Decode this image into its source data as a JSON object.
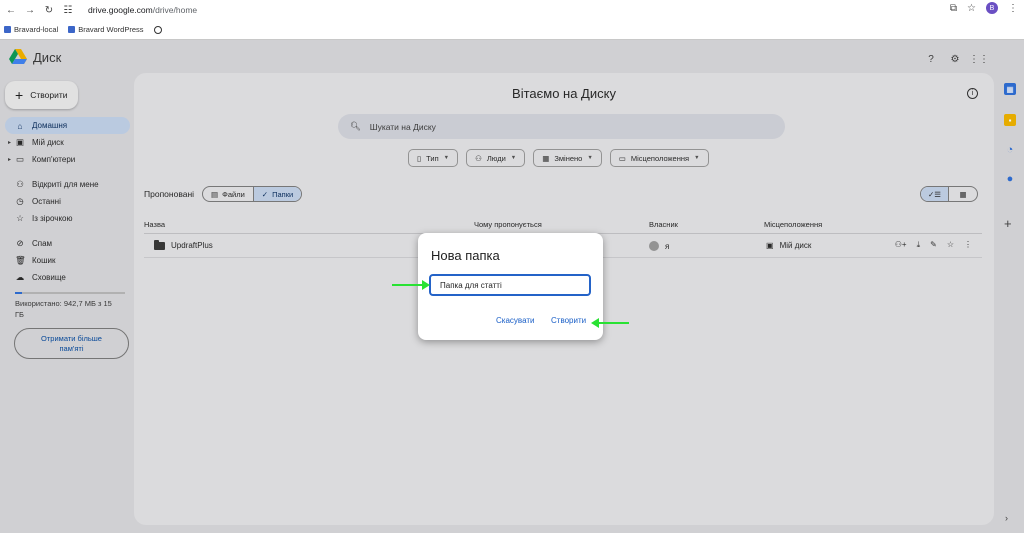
{
  "browser": {
    "url_host": "drive.google.com",
    "url_path": "/drive/home",
    "profile_initial": "B",
    "bookmarks": [
      {
        "label": "Bravard-local"
      },
      {
        "label": "Bravard WordPress"
      }
    ]
  },
  "app": {
    "name": "Диск",
    "create_label": "Створити",
    "profile_initial": "B"
  },
  "sidebar": {
    "items": [
      {
        "label": "Домашня"
      },
      {
        "label": "Мій диск"
      },
      {
        "label": "Комп'ютери"
      },
      {
        "label": "Відкриті для мене"
      },
      {
        "label": "Останні"
      },
      {
        "label": "Із зірочкою"
      },
      {
        "label": "Спам"
      },
      {
        "label": "Кошик"
      },
      {
        "label": "Сховище"
      }
    ],
    "storage_used_text": "Використано: 942,7 МБ з 15 ГБ",
    "storage_fraction": 0.061,
    "more_storage_label": "Отримати більше пам'яті"
  },
  "main": {
    "title": "Вітаємо на Диску",
    "search_placeholder": "Шукати на Диску",
    "filters": [
      {
        "label": "Тип"
      },
      {
        "label": "Люди"
      },
      {
        "label": "Змінено"
      },
      {
        "label": "Місцеположення"
      }
    ],
    "suggested_label": "Пропоновані",
    "seg_files": "Файли",
    "seg_folders": "Папки",
    "columns": {
      "name": "Назва",
      "reason": "Чому пропонується",
      "owner": "Власник",
      "location": "Місцеположення"
    },
    "rows": [
      {
        "name": "UpdraftPlus",
        "owner": "я",
        "location": "Мій диск"
      }
    ]
  },
  "dialog": {
    "title": "Нова папка",
    "input_value": "Папка для статті",
    "cancel_label": "Скасувати",
    "create_label": "Створити"
  },
  "colors": {
    "accent_blue": "#1a5fc7",
    "active_nav": "#c2d3ea",
    "annotation_arrow": "#29e233"
  }
}
